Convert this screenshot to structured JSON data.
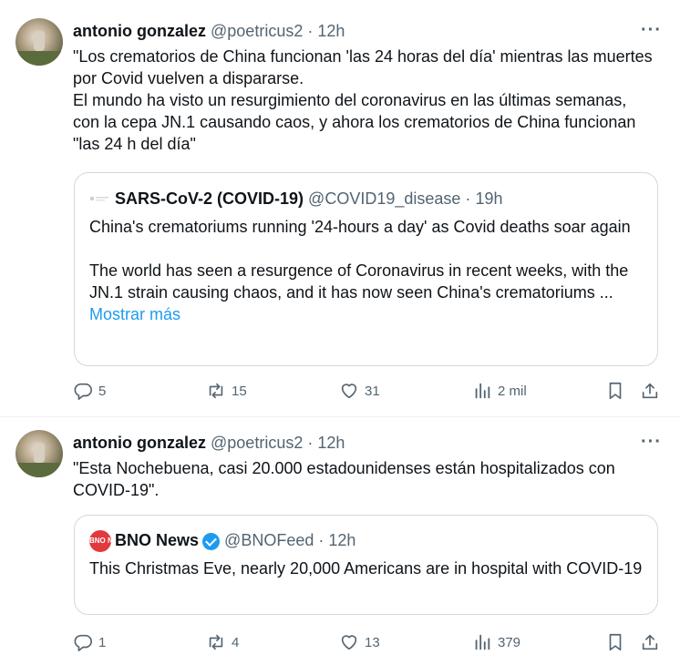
{
  "tweets": [
    {
      "author_name": "antonio gonzalez",
      "handle": "@poetricus2",
      "separator": "·",
      "time": "12h",
      "more": "···",
      "text_lines": [
        "\"Los crematorios de China funcionan 'las 24 horas del día' mientras las muertes por Covid vuelven a dispararse.",
        "El mundo ha visto un resurgimiento del coronavirus en las últimas semanas, con la cepa JN.1 causando caos, y ahora los crematorios de China funcionan \"las 24 h del día\""
      ],
      "quote": {
        "name": "SARS-CoV-2 (COVID-19)",
        "handle": "@COVID19_disease",
        "separator": "·",
        "time": "19h",
        "paragraphs": [
          "China's crematoriums running '24-hours a day' as Covid deaths soar again",
          "The world has seen a resurgence of Coronavirus in recent weeks, with the JN.1 strain causing chaos, and it has now seen China's crematoriums ..."
        ],
        "show_more": "Mostrar más"
      },
      "actions": {
        "replies": "5",
        "reposts": "15",
        "likes": "31",
        "views": "2 mil"
      }
    },
    {
      "author_name": "antonio gonzalez",
      "handle": "@poetricus2",
      "separator": "·",
      "time": "12h",
      "more": "···",
      "text_lines": [
        "\"Esta Nochebuena, casi 20.000 estadounidenses están hospitalizados con COVID-19\"."
      ],
      "quote": {
        "logo_text": "BNO NEWS",
        "name": "BNO News",
        "handle": "@BNOFeed",
        "separator": "·",
        "time": "12h",
        "paragraphs": [
          "This Christmas Eve, nearly 20,000 Americans are in hospital with COVID-19"
        ]
      },
      "actions": {
        "replies": "1",
        "reposts": "4",
        "likes": "13",
        "views": "379"
      }
    }
  ],
  "colors": {
    "text": "#0f1419",
    "secondary": "#536471",
    "link": "#1d9bf0",
    "border": "#cfd9de",
    "verified": "#1d9bf0",
    "bno_red": "#e0393e"
  }
}
